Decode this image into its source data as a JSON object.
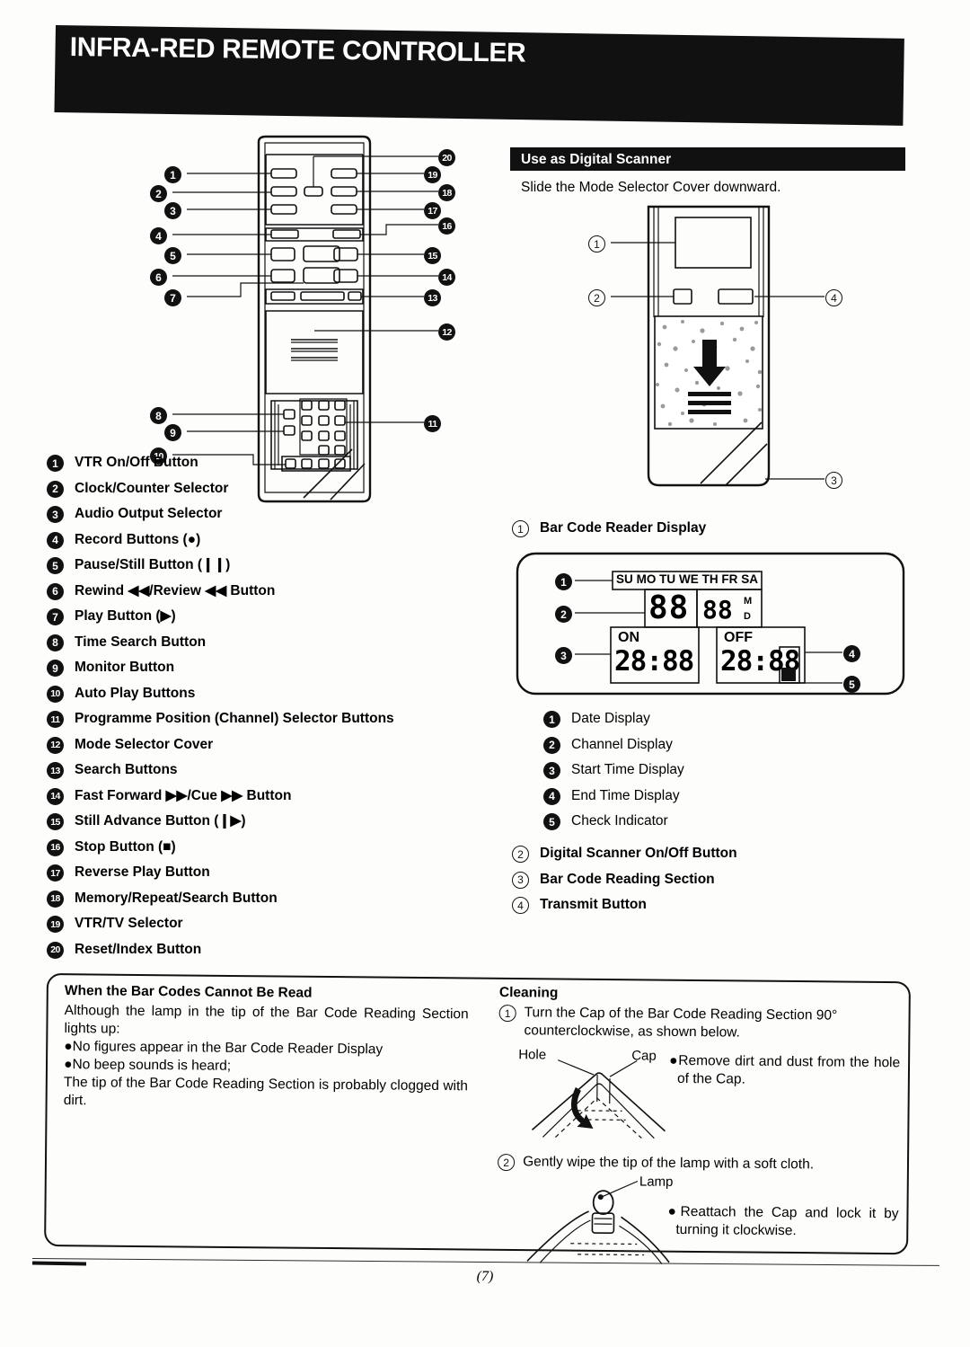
{
  "header": {
    "title": "INFRA-RED REMOTE CONTROLLER"
  },
  "remote_legend": {
    "items": [
      {
        "num": "1",
        "label": "VTR On/Off Button"
      },
      {
        "num": "2",
        "label": "Clock/Counter Selector"
      },
      {
        "num": "3",
        "label": "Audio Output Selector"
      },
      {
        "num": "4",
        "label": "Record Buttons (●)"
      },
      {
        "num": "5",
        "label": "Pause/Still Button (❙❙)"
      },
      {
        "num": "6",
        "label": "Rewind ◀◀/Review ◀◀ Button"
      },
      {
        "num": "7",
        "label": "Play Button (▶)"
      },
      {
        "num": "8",
        "label": "Time Search Button"
      },
      {
        "num": "9",
        "label": "Monitor Button"
      },
      {
        "num": "10",
        "label": "Auto Play Buttons"
      },
      {
        "num": "11",
        "label": "Programme Position (Channel) Selector Buttons"
      },
      {
        "num": "12",
        "label": "Mode Selector Cover"
      },
      {
        "num": "13",
        "label": "Search Buttons"
      },
      {
        "num": "14",
        "label": "Fast Forward ▶▶/Cue ▶▶ Button"
      },
      {
        "num": "15",
        "label": "Still Advance Button (❙▶)"
      },
      {
        "num": "16",
        "label": "Stop Button (■)"
      },
      {
        "num": "17",
        "label": "Reverse Play Button"
      },
      {
        "num": "18",
        "label": "Memory/Repeat/Search Button"
      },
      {
        "num": "19",
        "label": "VTR/TV Selector"
      },
      {
        "num": "20",
        "label": "Reset/Index Button"
      }
    ],
    "callouts": [
      "1",
      "2",
      "3",
      "4",
      "5",
      "6",
      "7",
      "8",
      "9",
      "10",
      "11",
      "12",
      "13",
      "14",
      "15",
      "16",
      "17",
      "18",
      "19",
      "20"
    ]
  },
  "scanner_section": {
    "heading": "Use as Digital Scanner",
    "intro": "Slide the Mode Selector Cover downward.",
    "diagram_callouts": [
      "1",
      "2",
      "3",
      "4"
    ],
    "first_item": {
      "num": "1",
      "label": "Bar Code Reader Display"
    },
    "display_items": [
      {
        "num": "1",
        "label": "Date Display"
      },
      {
        "num": "2",
        "label": "Channel Display"
      },
      {
        "num": "3",
        "label": "Start Time Display"
      },
      {
        "num": "4",
        "label": "End Time Display"
      },
      {
        "num": "5",
        "label": "Check Indicator"
      }
    ],
    "outer_items": [
      {
        "num": "2",
        "label": "Digital Scanner On/Off Button"
      },
      {
        "num": "3",
        "label": "Bar Code Reading Section"
      },
      {
        "num": "4",
        "label": "Transmit Button"
      }
    ],
    "lcd": {
      "days": [
        "SU",
        "MO",
        "TU",
        "WE",
        "TH",
        "FR",
        "SA"
      ],
      "channel": "88",
      "date": "88",
      "date_units": [
        "M",
        "D"
      ],
      "on_label": "ON",
      "on_time": "28:88",
      "off_label": "OFF",
      "off_time": "28:88"
    }
  },
  "troubleshoot": {
    "heading": "When the Bar Codes Cannot Be Read",
    "intro": "Although the lamp in the tip of the Bar Code Reading Section lights up:",
    "bullets": [
      "No figures appear in the Bar Code Reader Display",
      "No beep sounds is heard;"
    ],
    "outro": "The tip of the Bar Code Reading Section is probably clogged with dirt."
  },
  "cleaning": {
    "heading": "Cleaning",
    "step1_num": "1",
    "step1_text": "Turn the Cap of the Bar Code Reading Section 90° counterclockwise, as shown below.",
    "diagram1_labels": {
      "hole": "Hole",
      "cap": "Cap"
    },
    "note1": "Remove dirt and dust from the hole of the Cap.",
    "step2_num": "2",
    "step2_text": "Gently wipe the tip of the lamp with a soft cloth.",
    "diagram2_labels": {
      "lamp": "Lamp"
    },
    "note2": "Reattach the Cap and lock it by turning it clockwise."
  },
  "footer": {
    "page_number": "(7)"
  }
}
